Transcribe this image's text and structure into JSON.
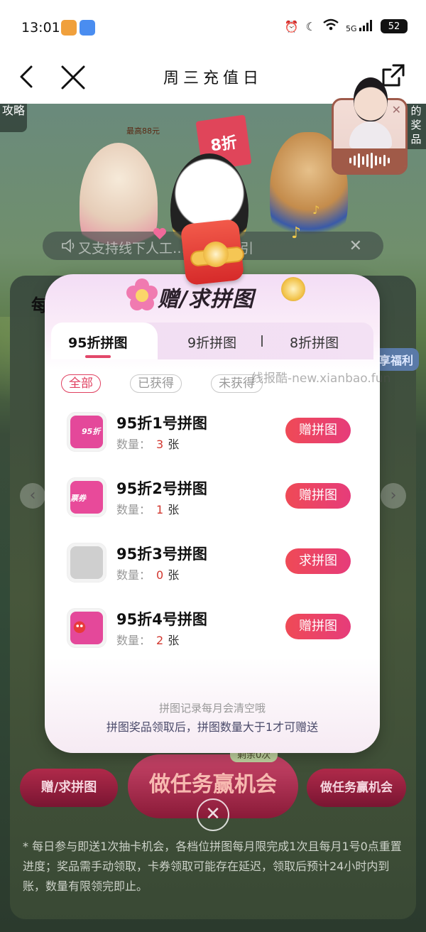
{
  "status_bar": {
    "time": "13:01",
    "network": "5G",
    "battery": "52"
  },
  "nav": {
    "title": "周三充值日"
  },
  "background": {
    "strategy_label": "攻略",
    "prize_label": "的奖品",
    "banner_price_label": "最高88元",
    "banner_discount_label": "8折",
    "marquee_text": "又支持线下人工…出票，每引"
  },
  "underlying_page": {
    "section_title": "每",
    "fuli_label": "享福利",
    "remaining_label": "剩余0次",
    "buttons": {
      "left": "赠/求拼图",
      "middle": "做任务赢机会",
      "right": "做任务赢机会"
    },
    "rules": "* 每日参与即送1次抽卡机会，各档位拼图每月限完成1次且每月1号0点重置进度；奖品需手动领取，卡券领取可能存在延迟，领取后预计24小时内到账，数量有限领完即止。"
  },
  "modal": {
    "title": "赠/求拼图",
    "tabs": [
      {
        "label": "95折拼图",
        "active": true
      },
      {
        "label": "9折拼图",
        "active": false
      },
      {
        "label": "8折拼图",
        "active": false
      }
    ],
    "filters": [
      {
        "label": "全部",
        "active": true
      },
      {
        "label": "已获得",
        "active": false
      },
      {
        "label": "未获得",
        "active": false
      }
    ],
    "watermark": "线报酷-new.xianbao.fun",
    "items": [
      {
        "name": "95折1号拼图",
        "qty_label": "数量：",
        "qty": "3",
        "unit": "张",
        "action": "赠拼图",
        "thumb_text": "95折",
        "thumb_color": "#e4489a"
      },
      {
        "name": "95折2号拼图",
        "qty_label": "数量：",
        "qty": "1",
        "unit": "张",
        "action": "赠拼图",
        "thumb_text": "票券",
        "thumb_color": "#e84a9a"
      },
      {
        "name": "95折3号拼图",
        "qty_label": "数量：",
        "qty": "0",
        "unit": "张",
        "action": "求拼图",
        "thumb_text": "",
        "thumb_color": "#cccccc"
      },
      {
        "name": "95折4号拼图",
        "qty_label": "数量：",
        "qty": "2",
        "unit": "张",
        "action": "赠拼图",
        "thumb_text": "",
        "thumb_color": "#e4489a"
      }
    ],
    "footer_note_1": "拼图记录每月会清空哦",
    "footer_note_2": "拼图奖品领取后，拼图数量大于1才可赠送"
  },
  "colors": {
    "accent": "#e2486a",
    "button_gradient_start": "#ef4a56",
    "button_gradient_end": "#e63c7a",
    "qty_red": "#d2372f"
  }
}
